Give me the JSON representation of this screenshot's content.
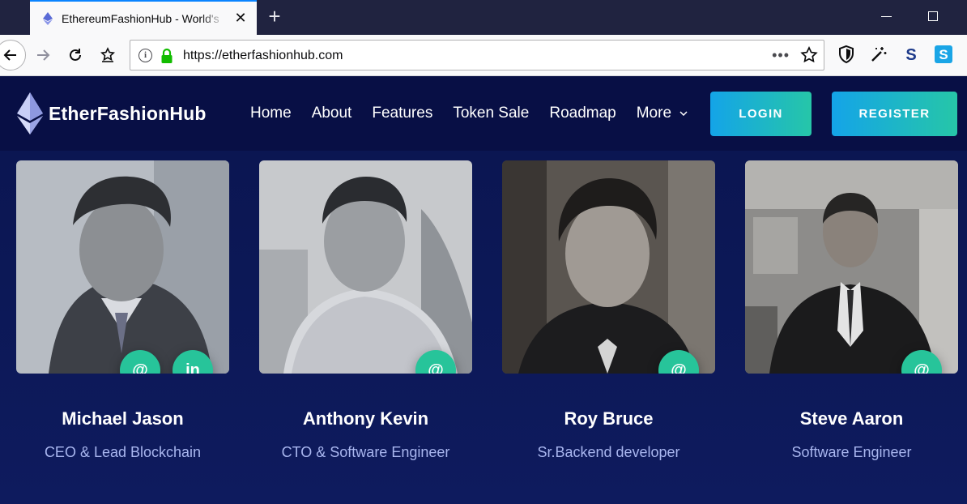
{
  "browser": {
    "tab_title": "EthereumFashionHub - World's",
    "url": "https://etherfashionhub.com",
    "url_dots": "•••"
  },
  "site": {
    "brand": "EtherFashionHub",
    "menu": [
      "Home",
      "About",
      "Features",
      "Token Sale",
      "Roadmap",
      "More"
    ],
    "login_label": "LOGIN",
    "register_label": "REGISTER"
  },
  "team": [
    {
      "name": "Michael Jason",
      "role": "CEO & Lead Blockchain",
      "socials": [
        "@",
        "in"
      ]
    },
    {
      "name": "Anthony Kevin",
      "role": "CTO & Software Engineer",
      "socials": [
        "@"
      ]
    },
    {
      "name": "Roy Bruce",
      "role": "Sr.Backend developer",
      "socials": [
        "@"
      ]
    },
    {
      "name": "Steve Aaron",
      "role": "Software Engineer",
      "socials": [
        "@"
      ]
    }
  ],
  "colors": {
    "accent_gradient_start": "#14a4e8",
    "accent_gradient_end": "#26c6a8",
    "social_button": "#27c49a",
    "header_bg": "#080f45",
    "section_bg": "#0d1a5c"
  }
}
